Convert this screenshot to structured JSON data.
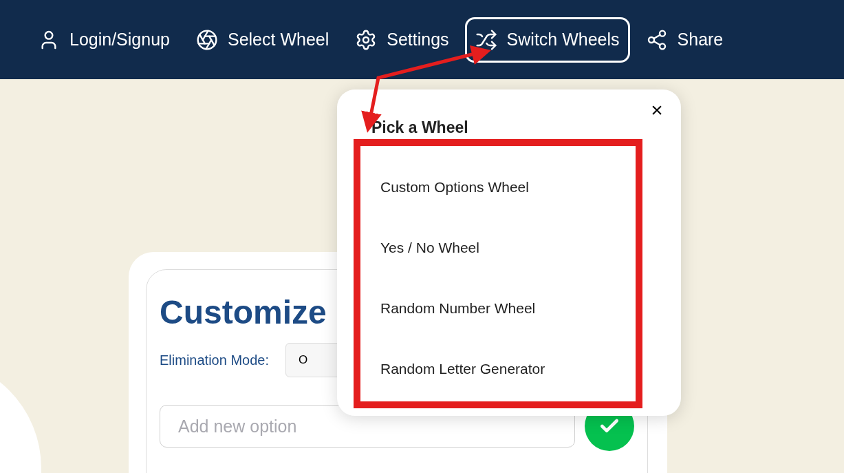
{
  "nav": [
    {
      "kind": "user",
      "label": "Login/Signup",
      "selected": false
    },
    {
      "kind": "wheel",
      "label": "Select Wheel",
      "selected": false
    },
    {
      "kind": "settings",
      "label": "Settings",
      "selected": false
    },
    {
      "kind": "shuffle",
      "label": "Switch Wheels",
      "selected": true
    },
    {
      "kind": "share",
      "label": "Share",
      "selected": false
    }
  ],
  "card": {
    "title": "Customize",
    "elimination_label": "Elimination Mode:",
    "elimination_value": "O",
    "input": {
      "placeholder": "Add new option"
    }
  },
  "popup": {
    "title": "Pick a Wheel",
    "close": "×",
    "items": [
      "Custom Options Wheel",
      "Yes / No Wheel",
      "Random Number Wheel",
      "Random Letter Generator"
    ]
  }
}
